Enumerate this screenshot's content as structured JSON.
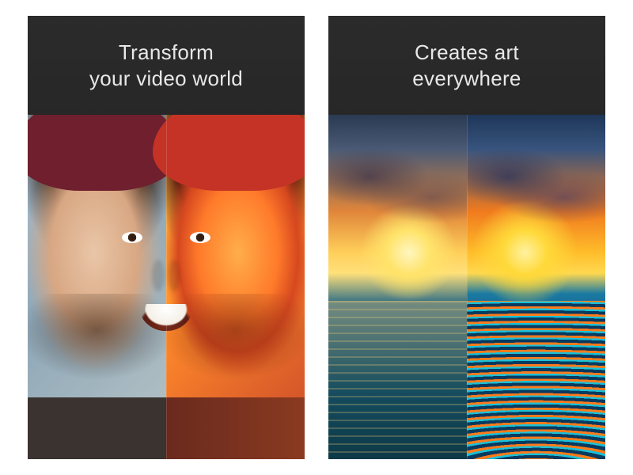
{
  "panels": [
    {
      "heading": "Transform\nyour video world",
      "image_description": "Split portrait of a smiling man wearing a maroon beanie; left half is the original photo, right half is rendered as a warm painterly art filter."
    },
    {
      "heading": "Creates art\neverywhere",
      "image_description": "Split seascape sunset; left half shows a natural ocean sunset photo, right half shows the same scene re-rendered with a vivid swirling art filter on the waves."
    }
  ]
}
